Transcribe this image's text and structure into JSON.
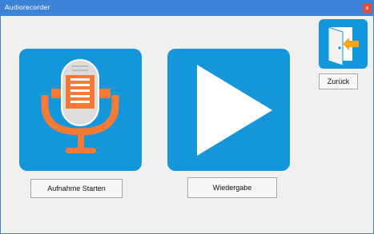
{
  "window": {
    "title": "Audiorecorder",
    "close_label": "x"
  },
  "tiles": {
    "record_icon": "microphone-icon",
    "play_icon": "play-icon",
    "back_icon": "exit-door-icon"
  },
  "buttons": {
    "record_label": "Aufnahme Starten",
    "playback_label": "Wiedergabe",
    "back_label": "Zurück"
  },
  "colors": {
    "titlebar": "#3d82d9",
    "tile_blue": "#1496db",
    "mic_orange": "#f47a35",
    "close_red": "#d9503f"
  }
}
